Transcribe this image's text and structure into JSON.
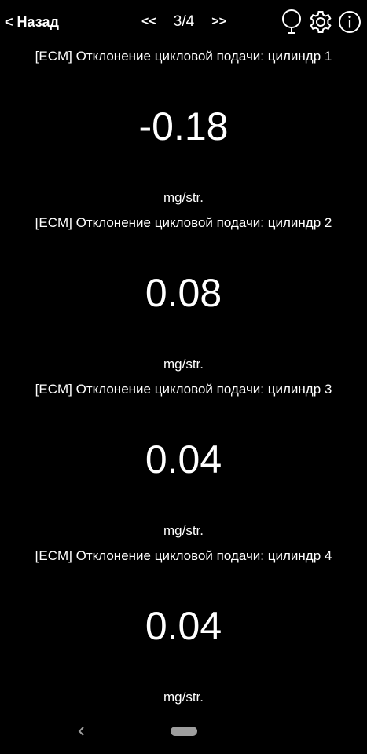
{
  "header": {
    "back_label": "< Назад",
    "prev_label": "<<",
    "page_indicator": "3/4",
    "next_label": ">>",
    "icons": [
      "balloon-icon",
      "gear-icon",
      "info-icon"
    ]
  },
  "params": [
    {
      "title": "[ECM] Отклонение цикловой подачи: цилиндр 1",
      "value": "-0.18",
      "unit": "mg/str."
    },
    {
      "title": "[ECM] Отклонение цикловой подачи: цилиндр 2",
      "value": "0.08",
      "unit": "mg/str."
    },
    {
      "title": "[ECM] Отклонение цикловой подачи: цилиндр 3",
      "value": "0.04",
      "unit": "mg/str."
    },
    {
      "title": "[ECM] Отклонение цикловой подачи: цилиндр 4",
      "value": "0.04",
      "unit": "mg/str."
    }
  ],
  "system_nav": {
    "back_icon": "chevron-left-icon",
    "home_icon": "home-pill-icon"
  },
  "colors": {
    "background": "#000000",
    "text": "#ffffff",
    "home_pill": "#9e9e9e"
  }
}
